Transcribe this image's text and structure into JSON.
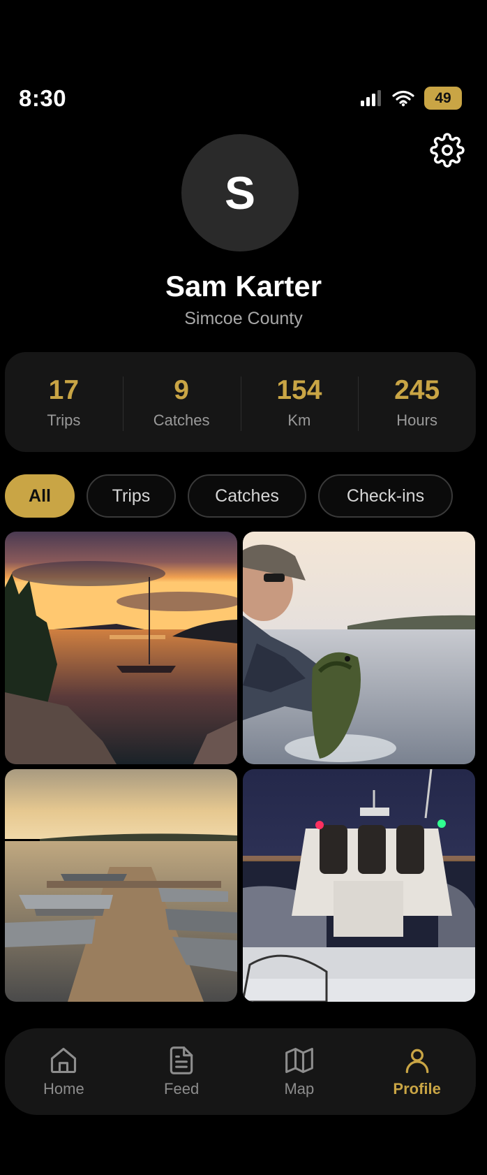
{
  "status_bar": {
    "time": "8:30",
    "battery": "49",
    "icons": [
      "signal-icon",
      "wifi-icon",
      "battery-icon"
    ]
  },
  "profile": {
    "avatar_initial": "S",
    "name": "Sam Karter",
    "location": "Simcoe County"
  },
  "stats": [
    {
      "value": "17",
      "label": "Trips"
    },
    {
      "value": "9",
      "label": "Catches"
    },
    {
      "value": "154",
      "label": "Km"
    },
    {
      "value": "245",
      "label": "Hours"
    }
  ],
  "filters": [
    {
      "label": "All",
      "active": true
    },
    {
      "label": "Trips",
      "active": false
    },
    {
      "label": "Catches",
      "active": false
    },
    {
      "label": "Check-ins",
      "active": false
    }
  ],
  "photos": [
    {
      "subject": "sunset-sailboat-photo"
    },
    {
      "subject": "angler-bass-photo"
    },
    {
      "subject": "dock-boats-photo"
    },
    {
      "subject": "night-boat-photo"
    }
  ],
  "bottom_nav": [
    {
      "label": "Home",
      "icon": "home-icon",
      "active": false
    },
    {
      "label": "Feed",
      "icon": "feed-icon",
      "active": false
    },
    {
      "label": "Map",
      "icon": "map-icon",
      "active": false
    },
    {
      "label": "Profile",
      "icon": "profile-icon",
      "active": true
    }
  ],
  "colors": {
    "accent": "#c9a545",
    "background": "#000000",
    "card": "#161616"
  }
}
